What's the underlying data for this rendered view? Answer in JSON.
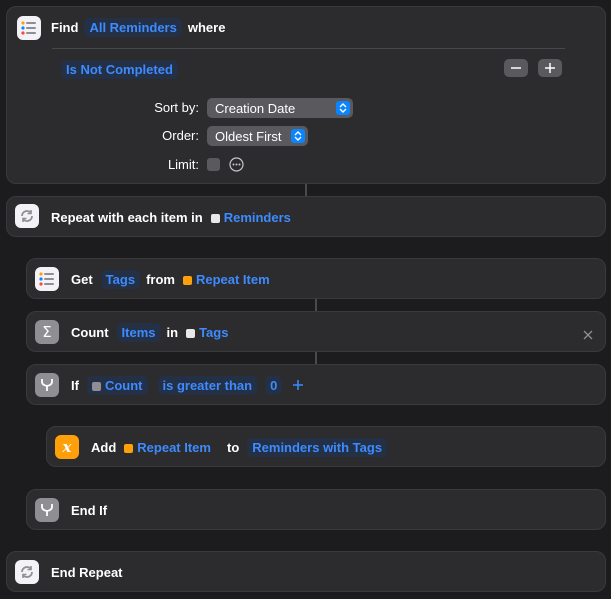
{
  "find": {
    "find_label": "Find",
    "reminders_token": "All Reminders",
    "where_label": "where",
    "filter_text": "Is Not Completed",
    "sort_by_label": "Sort by:",
    "sort_by_value": "Creation Date",
    "order_label": "Order:",
    "order_value": "Oldest First",
    "limit_label": "Limit:"
  },
  "repeat": {
    "label": "Repeat with each item in",
    "var_token": "Reminders"
  },
  "get": {
    "get_label": "Get",
    "tags_token": "Tags",
    "from_label": "from",
    "repeat_item_token": "Repeat Item"
  },
  "count": {
    "count_label": "Count",
    "items_token": "Items",
    "in_label": "in",
    "tags_var": "Tags"
  },
  "if": {
    "if_label": "If",
    "count_var": "Count",
    "condition": "is greater than",
    "value": "0"
  },
  "add": {
    "add_label": "Add",
    "repeat_item_token": "Repeat Item",
    "to_label": "to",
    "target": "Reminders with Tags"
  },
  "end_if": {
    "label": "End If"
  },
  "end_repeat": {
    "label": "End Repeat"
  }
}
